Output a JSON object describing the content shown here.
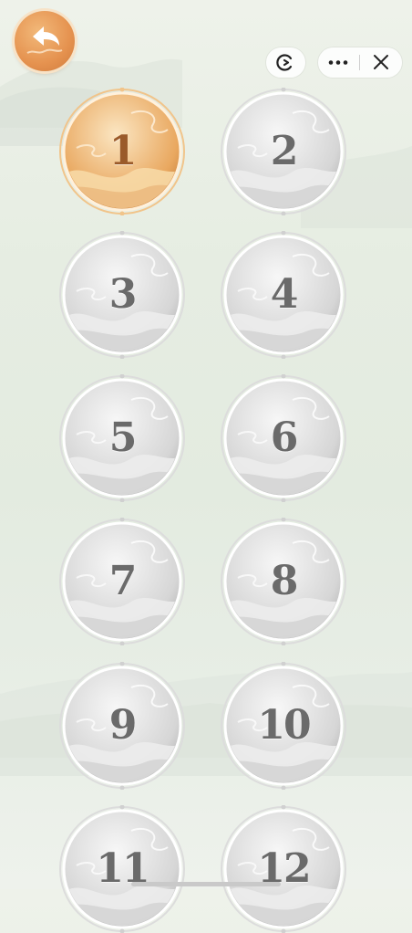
{
  "header": {
    "back_icon": "back-arrow-icon",
    "game_icon": "game-icon",
    "more_icon": "more-dots-icon",
    "close_icon": "close-icon"
  },
  "colors": {
    "active_level": "#e9a860",
    "locked_level": "#d9d9d9",
    "number_text": "#6a6a6a"
  },
  "levels": [
    {
      "label": "1",
      "active": true
    },
    {
      "label": "2",
      "active": false
    },
    {
      "label": "3",
      "active": false
    },
    {
      "label": "4",
      "active": false
    },
    {
      "label": "5",
      "active": false
    },
    {
      "label": "6",
      "active": false
    },
    {
      "label": "7",
      "active": false
    },
    {
      "label": "8",
      "active": false
    },
    {
      "label": "9",
      "active": false
    },
    {
      "label": "10",
      "active": false
    },
    {
      "label": "11",
      "active": false
    },
    {
      "label": "12",
      "active": false
    }
  ]
}
